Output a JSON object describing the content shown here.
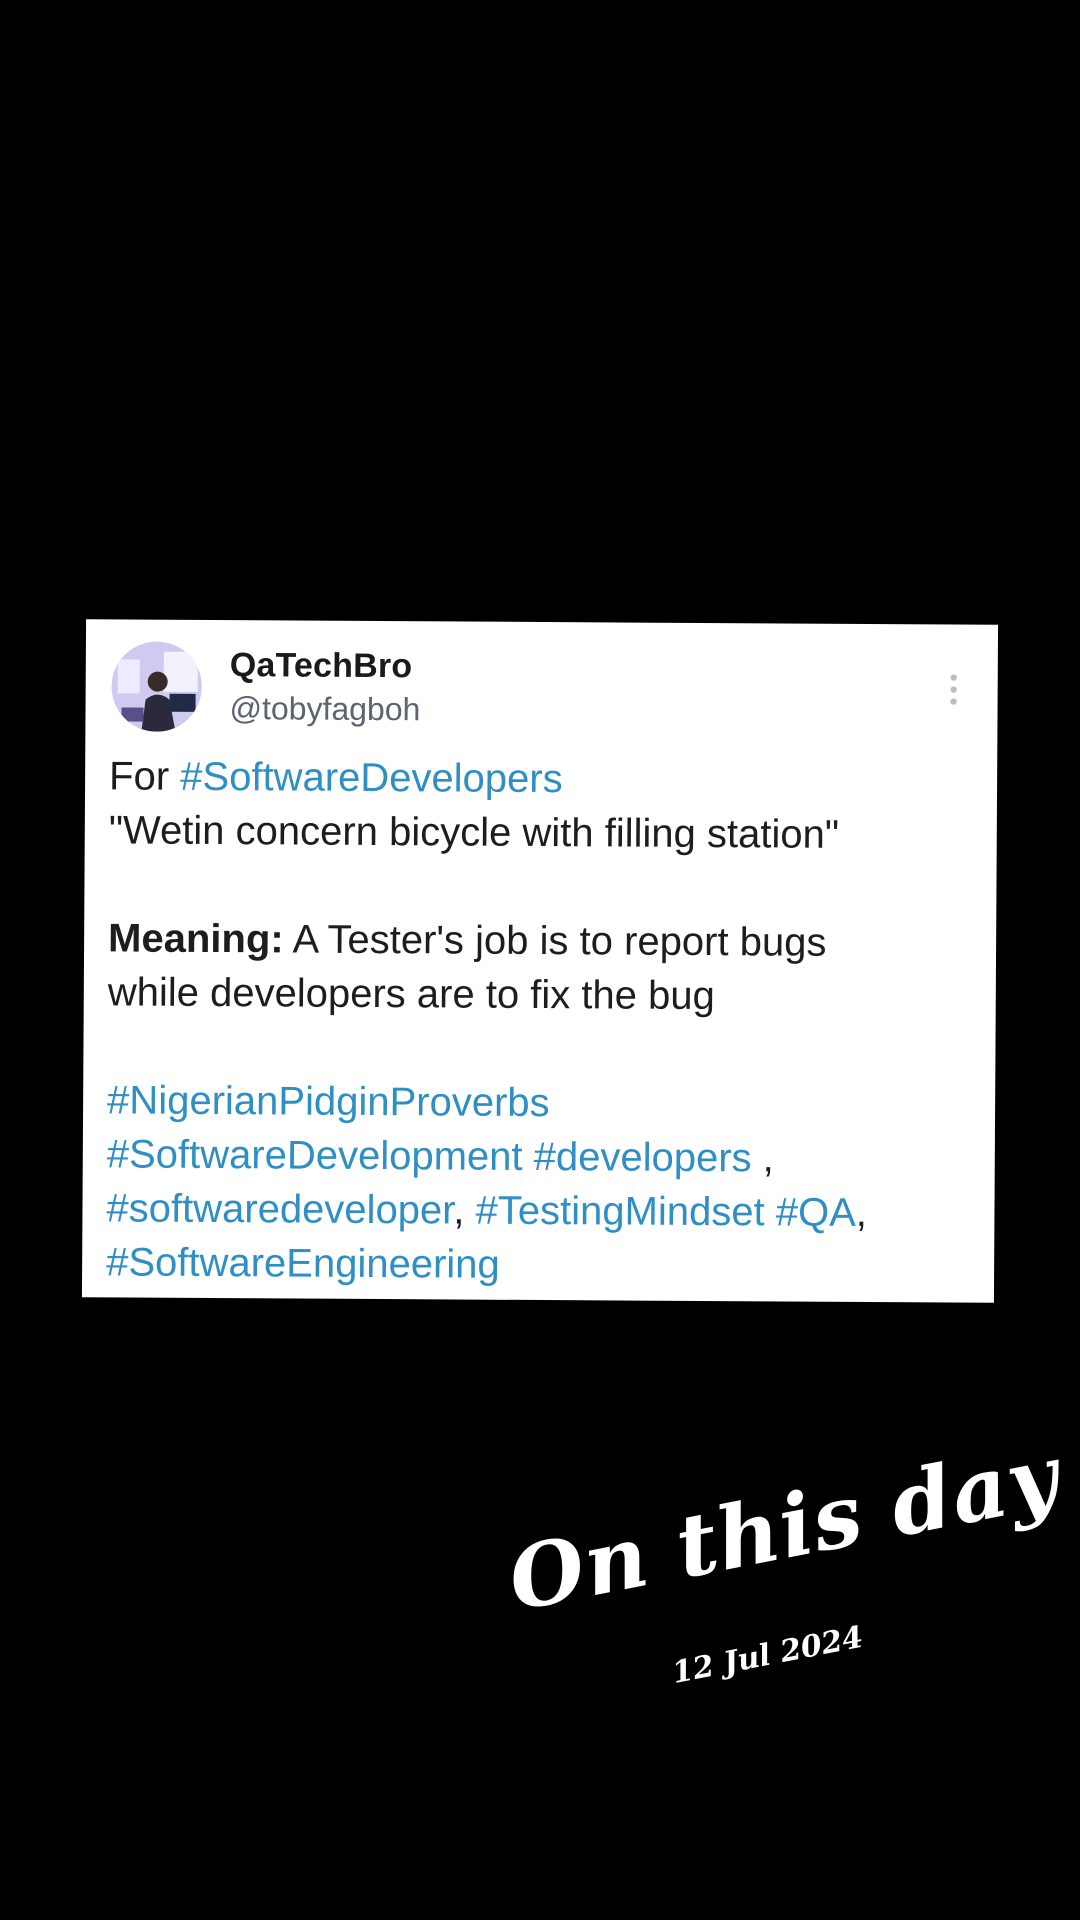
{
  "tweet": {
    "display_name": "QaTechBro",
    "handle": "@tobyfagboh",
    "line1_prefix": "For ",
    "line1_hashtag": "#SoftwareDevelopers",
    "line2": "\"Wetin concern bicycle with filling station\"",
    "meaning_label": "Meaning:",
    "meaning_text": " A Tester's job is to report bugs",
    "meaning_line2": "while developers are to fix the bug",
    "hashtag_nigerian": "#NigerianPidginProverbs",
    "hashtag_softwaredevelopment": "#SoftwareDevelopment",
    "hashtag_developers": "#developers",
    "sep_comma_space": " ,",
    "hashtag_softwaredeveloper": "#softwaredeveloper",
    "sep_comma": ",",
    "hashtag_testingmindset": "#TestingMindset",
    "hashtag_qa": "#QA",
    "sep_comma2": ",",
    "hashtag_softwareengineering": "#SoftwareEngineering"
  },
  "overlay": {
    "title": "On this day",
    "date": "12 Jul 2024"
  },
  "colors": {
    "background": "#000000",
    "card": "#ffffff",
    "hashtag": "#2f8fc4",
    "handle": "#5b6470"
  },
  "icons": {
    "more": "more-vertical-icon"
  }
}
